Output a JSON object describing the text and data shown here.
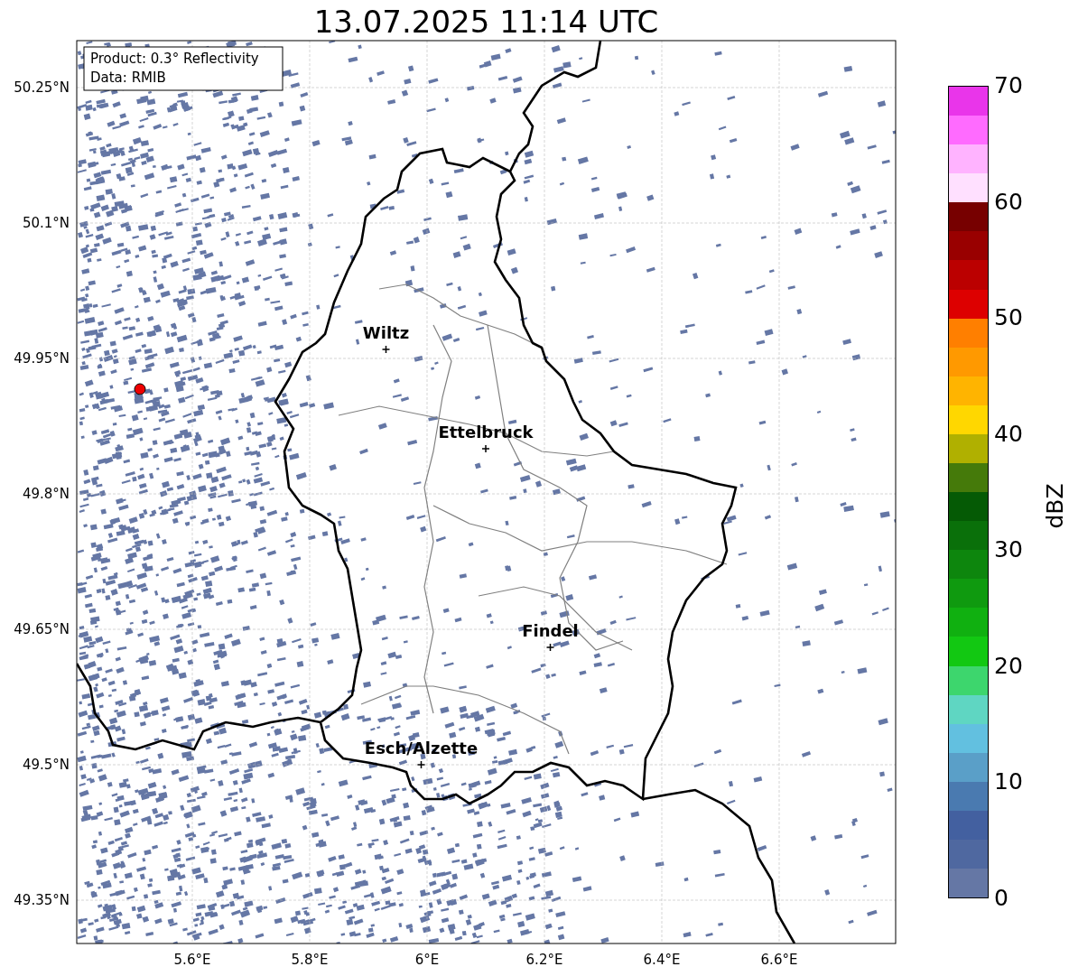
{
  "title": "13.07.2025 11:14 UTC",
  "info": [
    "Product: 0.3° Reflectivity",
    "Data: RMIB"
  ],
  "map": {
    "lat_labels": [
      "50.25°N",
      "50.1°N",
      "49.95°N",
      "49.8°N",
      "49.65°N",
      "49.5°N",
      "49.35°N"
    ],
    "lon_labels": [
      "5.6°E",
      "5.8°E",
      "6°E",
      "6.2°E",
      "6.4°E",
      "6.6°E"
    ],
    "cities": [
      {
        "name": "Wiltz"
      },
      {
        "name": "Ettelbruck"
      },
      {
        "name": "Findel"
      },
      {
        "name": "Esch/Alzette"
      }
    ]
  },
  "colorbar": {
    "label": "dBZ",
    "ticks": [
      "70",
      "60",
      "50",
      "40",
      "30",
      "20",
      "10",
      "0"
    ],
    "segments": [
      {
        "color": "#e935ea"
      },
      {
        "color": "#ff6bff"
      },
      {
        "color": "#ffb3ff"
      },
      {
        "color": "#ffe0ff"
      },
      {
        "color": "#770000"
      },
      {
        "color": "#990000"
      },
      {
        "color": "#bb0000"
      },
      {
        "color": "#dd0000"
      },
      {
        "color": "#ff7f00"
      },
      {
        "color": "#ff9900"
      },
      {
        "color": "#ffb400"
      },
      {
        "color": "#ffd700"
      },
      {
        "color": "#b0b000"
      },
      {
        "color": "#457a0a"
      },
      {
        "color": "#055a05"
      },
      {
        "color": "#0a700a"
      },
      {
        "color": "#0d860d"
      },
      {
        "color": "#0f9a0f"
      },
      {
        "color": "#10b010"
      },
      {
        "color": "#12c812"
      },
      {
        "color": "#3dd66d"
      },
      {
        "color": "#5fd6c2"
      },
      {
        "color": "#62c0e0"
      },
      {
        "color": "#5a9fc8"
      },
      {
        "color": "#4a7ab0"
      },
      {
        "color": "#4360a0"
      },
      {
        "color": "#4f68a0"
      },
      {
        "color": "#6577a5"
      }
    ]
  }
}
